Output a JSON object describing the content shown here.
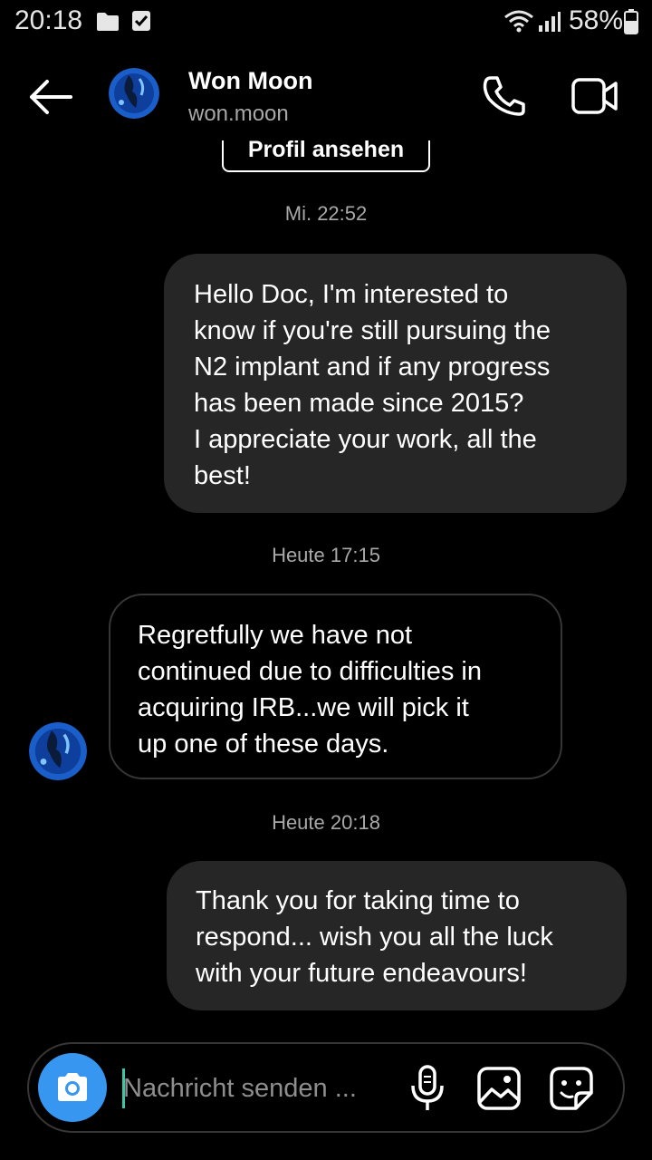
{
  "status_bar": {
    "time": "20:18",
    "battery": "58%",
    "icons": [
      "folder-icon",
      "checkbox-icon",
      "wifi-icon",
      "signal-icon",
      "battery-icon"
    ]
  },
  "header": {
    "name": "Won Moon",
    "username": "won.moon",
    "icons": [
      "back-arrow-icon",
      "phone-icon",
      "video-camera-icon"
    ]
  },
  "thread": {
    "profile_button": "Profil ansehen",
    "timestamps": [
      "Mi. 22:52",
      "Heute 17:15",
      "Heute 20:18"
    ],
    "messages": [
      {
        "direction": "outgoing",
        "text": "Hello Doc, I'm interested to\nknow if you're still pursuing the\nN2 implant and if any progress\nhas been made since 2015?\nI appreciate your work, all the\nbest!"
      },
      {
        "direction": "incoming",
        "text": "Regretfully we have not\ncontinued due to difficulties in\nacquiring IRB...we will pick it\nup one of these days."
      },
      {
        "direction": "outgoing",
        "text": "Thank you for taking time to\nrespond... wish you all the luck\nwith your future endeavours!"
      }
    ]
  },
  "composer": {
    "placeholder": "Nachricht senden ...",
    "icons": [
      "camera-icon",
      "microphone-icon",
      "gallery-icon",
      "sticker-icon"
    ]
  },
  "colors": {
    "background": "#000000",
    "outgoing_bubble": "#262626",
    "incoming_border": "#363636",
    "accent": "#3797f0",
    "secondary_text": "#a8a8a8"
  }
}
